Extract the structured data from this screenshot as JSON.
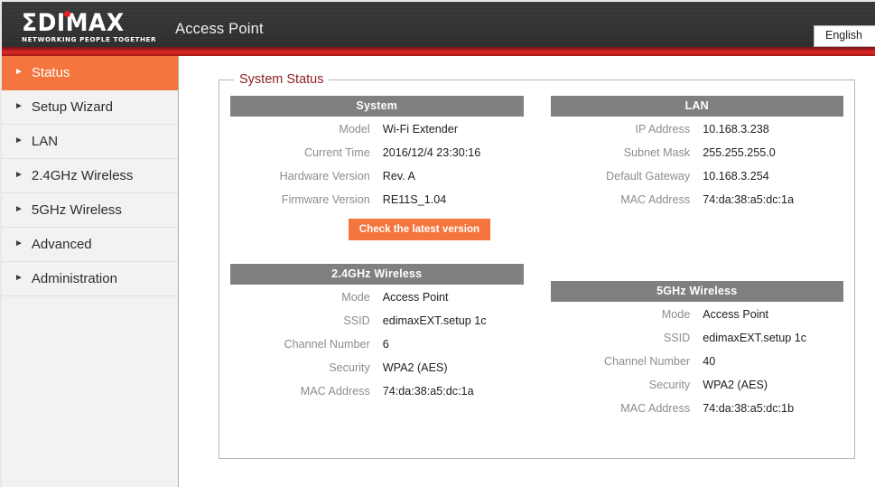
{
  "header": {
    "logo_word": "ΣDIMAX",
    "logo_tagline": "NETWORKING PEOPLE TOGETHER",
    "title": "Access Point",
    "language": "English"
  },
  "sidebar": {
    "items": [
      {
        "label": "Status",
        "active": true
      },
      {
        "label": "Setup Wizard",
        "active": false
      },
      {
        "label": "LAN",
        "active": false
      },
      {
        "label": "2.4GHz Wireless",
        "active": false
      },
      {
        "label": "5GHz Wireless",
        "active": false
      },
      {
        "label": "Advanced",
        "active": false
      },
      {
        "label": "Administration",
        "active": false
      }
    ],
    "arrow_glyph": "►"
  },
  "main": {
    "legend": "System Status",
    "panels": {
      "system": {
        "title": "System",
        "rows": [
          {
            "label": "Model",
            "value": "Wi-Fi Extender"
          },
          {
            "label": "Current Time",
            "value": "2016/12/4  23:30:16"
          },
          {
            "label": "Hardware Version",
            "value": "Rev. A"
          },
          {
            "label": "Firmware Version",
            "value": "RE11S_1.04"
          }
        ],
        "button_label": "Check the latest version"
      },
      "lan": {
        "title": "LAN",
        "rows": [
          {
            "label": "IP Address",
            "value": "10.168.3.238"
          },
          {
            "label": "Subnet Mask",
            "value": "255.255.255.0"
          },
          {
            "label": "Default Gateway",
            "value": "10.168.3.254"
          },
          {
            "label": "MAC Address",
            "value": "74:da:38:a5:dc:1a"
          }
        ]
      },
      "wireless_24": {
        "title": "2.4GHz  Wireless",
        "rows": [
          {
            "label": "Mode",
            "value": "Access Point"
          },
          {
            "label": "SSID",
            "value": "edimaxEXT.setup 1c"
          },
          {
            "label": "Channel Number",
            "value": "6"
          },
          {
            "label": "Security",
            "value": "WPA2 (AES)"
          },
          {
            "label": "MAC Address",
            "value": "74:da:38:a5:dc:1a"
          }
        ]
      },
      "wireless_5": {
        "title": "5GHz  Wireless",
        "rows": [
          {
            "label": "Mode",
            "value": "Access Point"
          },
          {
            "label": "SSID",
            "value": "edimaxEXT.setup 1c"
          },
          {
            "label": "Channel Number",
            "value": "40"
          },
          {
            "label": "Security",
            "value": "WPA2 (AES)"
          },
          {
            "label": "MAC Address",
            "value": "74:da:38:a5:dc:1b"
          }
        ]
      }
    }
  },
  "colors": {
    "accent_orange": "#f4753d",
    "header_dark": "#333333",
    "header_stripe_red": "#c5201f",
    "panel_head_gray": "#808080",
    "legend_maroon": "#8c2020",
    "logo_dot_red": "#ea1d25"
  }
}
